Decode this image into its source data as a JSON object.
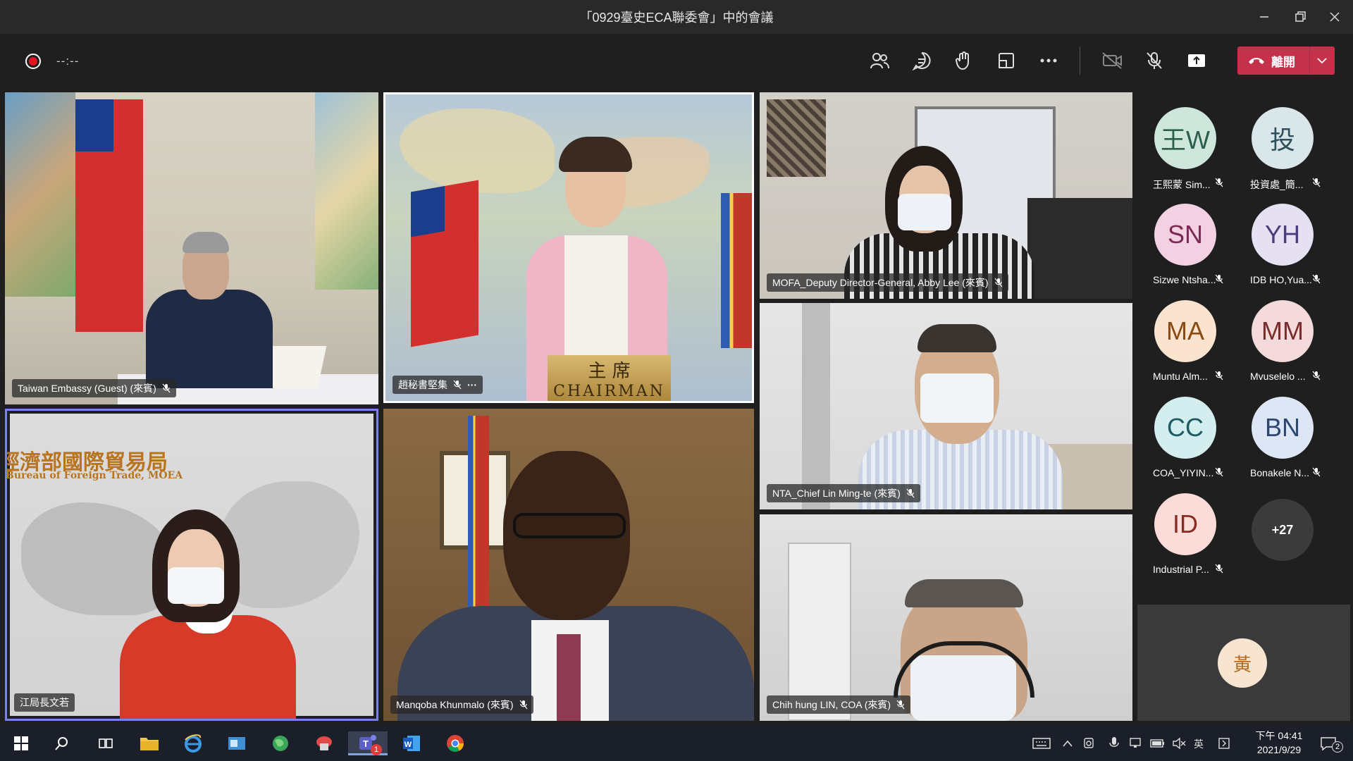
{
  "window": {
    "title": "「0929臺史ECA聯委會」中的會議"
  },
  "toolbar": {
    "timer": "--:--",
    "leave_label": "離開"
  },
  "tiles": [
    {
      "name": "Taiwan Embassy (Guest) (來賓)"
    },
    {
      "name": "趙秘書堅集",
      "more": "···"
    },
    {
      "name": "MOFA_Deputy Director-General, Abby Lee (來賓)"
    },
    {
      "name": "江局長文若",
      "banner_cn": "經濟部國際貿易局",
      "banner_en": "Bureau of Foreign Trade, MOEA"
    },
    {
      "name": "Manqoba Khunmalo (來賓)"
    },
    {
      "name": "NTA_Chief Lin Ming-te (來賓)"
    },
    {
      "name": "Chih hung LIN, COA (來賓)"
    }
  ],
  "chairman_plaque": {
    "cn": "主 席",
    "en": "CHAIRMAN"
  },
  "participants": [
    {
      "initials": "王W",
      "name": "王熙蒙 Sim...",
      "color": "#cfe6dc",
      "text_color": "#2c5e4c"
    },
    {
      "initials": "投",
      "name": "投資處_簡...",
      "color": "#d9e6ea",
      "text_color": "#2f4f5a"
    },
    {
      "initials": "SN",
      "name": "Sizwe Ntsha...",
      "color": "#f3d1e3",
      "text_color": "#7a2a55"
    },
    {
      "initials": "YH",
      "name": "IDB HO,Yua...",
      "color": "#e5e0f2",
      "text_color": "#4b3c7a"
    },
    {
      "initials": "MA",
      "name": "Muntu Alm...",
      "color": "#fbe4cf",
      "text_color": "#8a4a14"
    },
    {
      "initials": "MM",
      "name": "Mvuselelo ...",
      "color": "#f4dada",
      "text_color": "#7a2c2c"
    },
    {
      "initials": "CC",
      "name": "COA_YIYIN...",
      "color": "#d4eef0",
      "text_color": "#1d5c62"
    },
    {
      "initials": "BN",
      "name": "Bonakele N...",
      "color": "#dde6f4",
      "text_color": "#2c4670"
    },
    {
      "initials": "ID",
      "name": "Industrial P...",
      "color": "#fbdcd8",
      "text_color": "#8a2b22"
    }
  ],
  "overflow_count": "+27",
  "self": {
    "initials": "黃"
  },
  "taskbar": {
    "ime": "英",
    "time": "下午 04:41",
    "date": "2021/9/29",
    "notifications": "2",
    "teams_badge": "1"
  }
}
